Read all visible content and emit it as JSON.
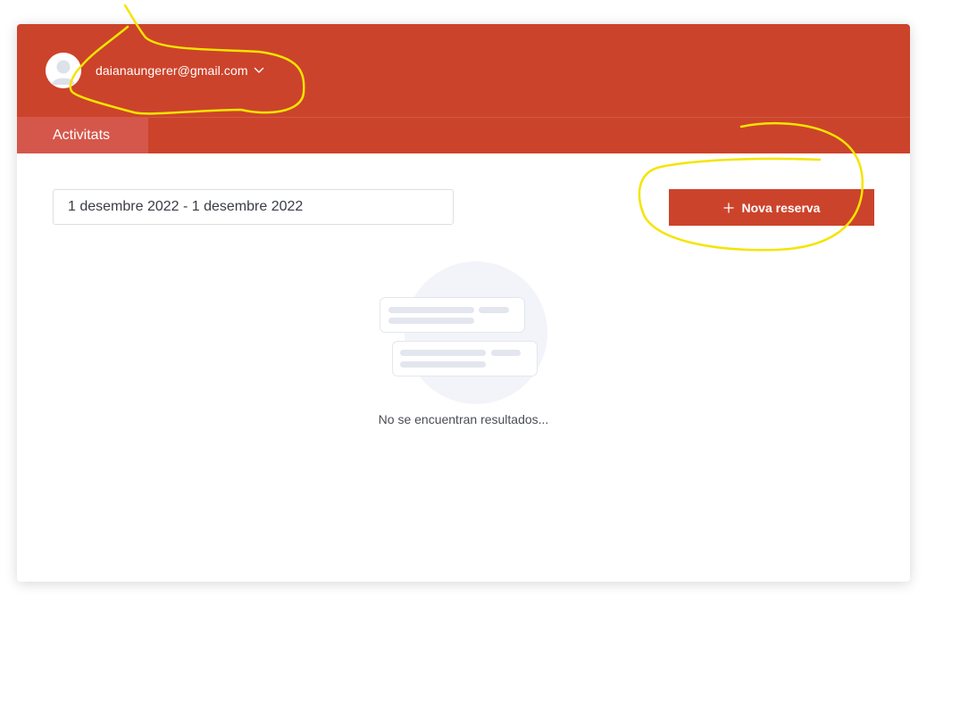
{
  "header": {
    "user_email": "daianaungerer@gmail.com",
    "avatar_icon": "user-avatar-icon",
    "dropdown_icon": "chevron-down-icon"
  },
  "tabs": [
    {
      "label": "Activitats",
      "active": true
    }
  ],
  "filters": {
    "date_range": "1 desembre 2022 - 1 desembre 2022"
  },
  "actions": {
    "new_booking_label": "Nova reserva",
    "new_booking_icon": "plus-icon"
  },
  "empty_state": {
    "message": "No se encuentran resultados...",
    "illustration_icon": "empty-list-icon"
  },
  "colors": {
    "brand": "#cc432b",
    "active_tab": "#d5574b",
    "annotation": "#f5e400"
  }
}
